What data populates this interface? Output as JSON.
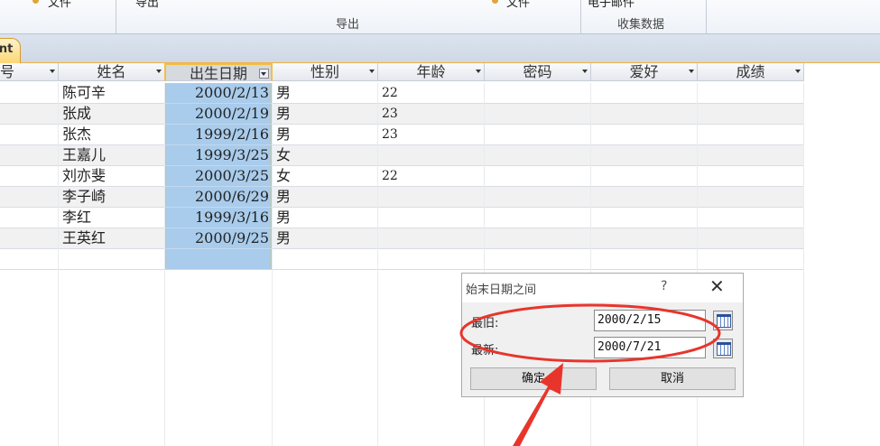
{
  "ribbon": {
    "item_left": "文件",
    "item_export_top": "导出",
    "group_export": "导出",
    "item_right": "文件",
    "item_email": "电子邮件",
    "group_collect": "收集数据"
  },
  "doc_tab": {
    "label": "ent"
  },
  "columns": [
    {
      "label": "号"
    },
    {
      "label": "姓名"
    },
    {
      "label": "出生日期"
    },
    {
      "label": "性别"
    },
    {
      "label": "年龄"
    },
    {
      "label": "密码"
    },
    {
      "label": "爱好"
    },
    {
      "label": "成绩"
    }
  ],
  "rows": [
    {
      "name": "陈可辛",
      "birth": "2000/2/13",
      "gender": "男",
      "age": "22"
    },
    {
      "name": "张成",
      "birth": "2000/2/19",
      "gender": "男",
      "age": "23"
    },
    {
      "name": "张杰",
      "birth": "1999/2/16",
      "gender": "男",
      "age": "23"
    },
    {
      "name": "王嘉儿",
      "birth": "1999/3/25",
      "gender": "女",
      "age": ""
    },
    {
      "name": "刘亦斐",
      "birth": "2000/3/25",
      "gender": "女",
      "age": "22"
    },
    {
      "name": "李子崎",
      "birth": "2000/6/29",
      "gender": "男",
      "age": ""
    },
    {
      "name": "李红",
      "birth": "1999/3/16",
      "gender": "男",
      "age": ""
    },
    {
      "name": "王英红",
      "birth": "2000/9/25",
      "gender": "男",
      "age": ""
    }
  ],
  "dialog": {
    "title": "始末日期之间",
    "help": "?",
    "close": "✕",
    "label_old": "最旧:",
    "value_old": "2000/2/15",
    "label_new": "最新:",
    "value_new": "2000/7/21",
    "ok": "确定",
    "cancel": "取消"
  },
  "colors": {
    "selection": "#a9ccec",
    "selection_border": "#f0c040",
    "annotation": "#e8352c"
  }
}
